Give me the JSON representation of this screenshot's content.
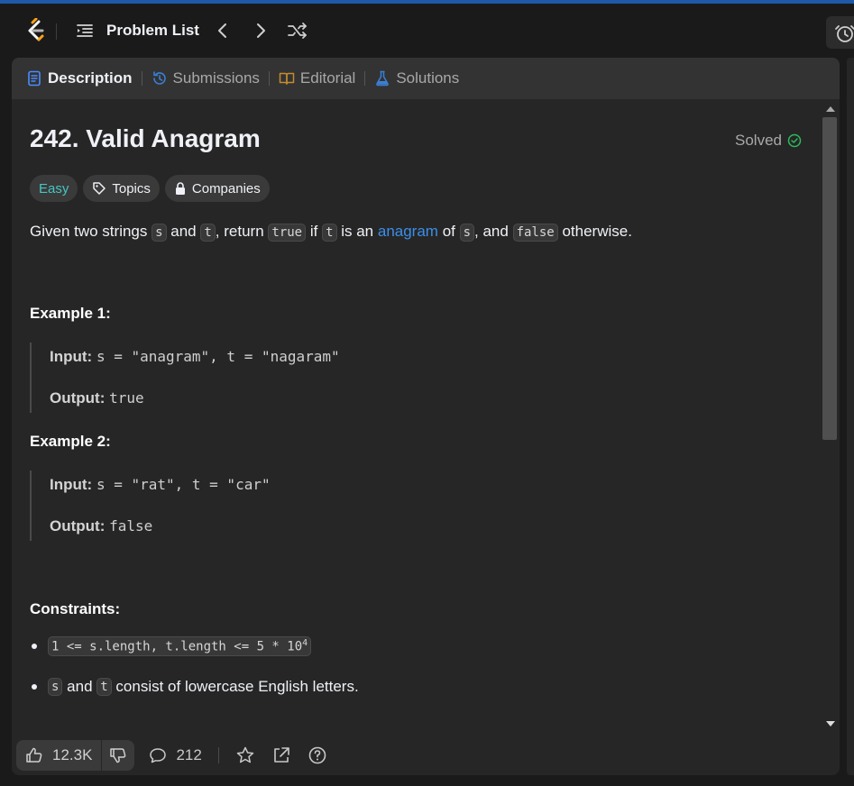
{
  "header": {
    "problem_list_label": "Problem List"
  },
  "tabs": [
    {
      "label": "Description",
      "icon": "document-icon",
      "color": "#4a8cff"
    },
    {
      "label": "Submissions",
      "icon": "history-icon",
      "color": "#3b7fd4"
    },
    {
      "label": "Editorial",
      "icon": "book-icon",
      "color": "#c48b2f"
    },
    {
      "label": "Solutions",
      "icon": "flask-icon",
      "color": "#3b7fd4"
    }
  ],
  "problem": {
    "title": "242. Valid Anagram",
    "status": "Solved",
    "difficulty": "Easy",
    "topics_label": "Topics",
    "companies_label": "Companies"
  },
  "description": {
    "p1": "Given two strings ",
    "s": "s",
    "p2": " and ",
    "t": "t",
    "p3": ", return ",
    "true": "true",
    "p4": " if ",
    "t2": "t",
    "p5": " is an ",
    "anagram": "anagram",
    "p6": " of ",
    "s2": "s",
    "p7": ", and ",
    "false": "false",
    "p8": " otherwise."
  },
  "examples": [
    {
      "heading": "Example 1:",
      "input_label": "Input:",
      "input": "s = \"anagram\", t = \"nagaram\"",
      "output_label": "Output:",
      "output": "true"
    },
    {
      "heading": "Example 2:",
      "input_label": "Input:",
      "input": "s = \"rat\", t = \"car\"",
      "output_label": "Output:",
      "output": "false"
    }
  ],
  "constraints": {
    "heading": "Constraints:",
    "c1": "1 <= s.length, t.length <= 5 * 10",
    "c1_sup": "4",
    "c2_s": "s",
    "c2_and": " and ",
    "c2_t": "t",
    "c2_rest": " consist of lowercase English letters."
  },
  "footer": {
    "likes": "12.3K",
    "comments": "212"
  },
  "colors": {
    "accent_blue": "#3b8eea",
    "easy": "#46c6c2",
    "solved_check": "#2cbb5d"
  }
}
